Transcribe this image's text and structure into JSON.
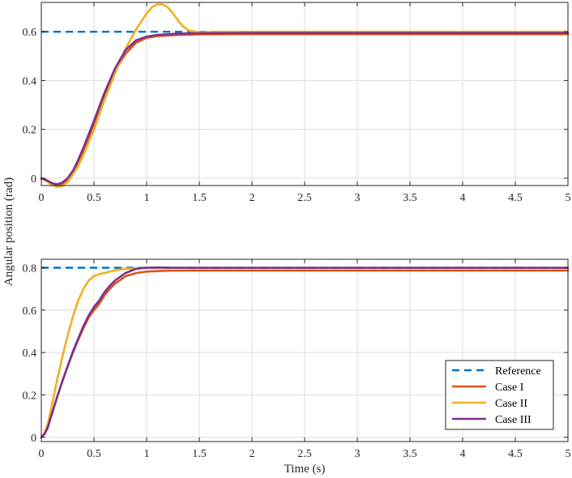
{
  "colors": {
    "reference": "#0072BD",
    "case1": "#D95319",
    "case2": "#EDB120",
    "case3": "#7E2F8E",
    "grid": "#DCDCDC",
    "axis": "#262626"
  },
  "labels": {
    "ylabel": "Angular position (rad)",
    "xlabel": "Time (s)"
  },
  "chart_data": [
    {
      "type": "line",
      "title": "",
      "grid": true,
      "xlim": [
        0,
        5
      ],
      "ylim": [
        -0.03,
        0.72
      ],
      "xticks": [
        "0",
        "0.5",
        "1",
        "1.5",
        "2",
        "2.5",
        "3",
        "3.5",
        "4",
        "4.5",
        "5"
      ],
      "yticks": [
        "0",
        "0.2",
        "0.4",
        "0.6"
      ],
      "series": [
        {
          "name": "Reference",
          "style": "dashed",
          "color": "#0072BD",
          "points": [
            [
              0,
              0.6
            ],
            [
              5,
              0.6
            ]
          ]
        },
        {
          "name": "Case I",
          "style": "solid",
          "color": "#D95319",
          "points": [
            [
              0,
              0
            ],
            [
              0.05,
              -0.01
            ],
            [
              0.1,
              -0.025
            ],
            [
              0.15,
              -0.032
            ],
            [
              0.2,
              -0.028
            ],
            [
              0.25,
              -0.01
            ],
            [
              0.3,
              0.02
            ],
            [
              0.35,
              0.06
            ],
            [
              0.4,
              0.11
            ],
            [
              0.5,
              0.22
            ],
            [
              0.6,
              0.34
            ],
            [
              0.7,
              0.44
            ],
            [
              0.8,
              0.51
            ],
            [
              0.9,
              0.555
            ],
            [
              1.0,
              0.575
            ],
            [
              1.1,
              0.582
            ],
            [
              1.3,
              0.587
            ],
            [
              1.5,
              0.589
            ],
            [
              2,
              0.59
            ],
            [
              5,
              0.59
            ]
          ]
        },
        {
          "name": "Case II",
          "style": "solid",
          "color": "#EDB120",
          "points": [
            [
              0,
              0
            ],
            [
              0.05,
              -0.012
            ],
            [
              0.1,
              -0.028
            ],
            [
              0.15,
              -0.036
            ],
            [
              0.2,
              -0.032
            ],
            [
              0.25,
              -0.015
            ],
            [
              0.3,
              0.015
            ],
            [
              0.35,
              0.05
            ],
            [
              0.4,
              0.095
            ],
            [
              0.5,
              0.2
            ],
            [
              0.6,
              0.32
            ],
            [
              0.7,
              0.43
            ],
            [
              0.8,
              0.53
            ],
            [
              0.9,
              0.61
            ],
            [
              1.0,
              0.675
            ],
            [
              1.05,
              0.7
            ],
            [
              1.1,
              0.712
            ],
            [
              1.15,
              0.712
            ],
            [
              1.2,
              0.7
            ],
            [
              1.25,
              0.675
            ],
            [
              1.3,
              0.645
            ],
            [
              1.35,
              0.62
            ],
            [
              1.4,
              0.605
            ],
            [
              1.5,
              0.598
            ],
            [
              1.7,
              0.6
            ],
            [
              2,
              0.6
            ],
            [
              5,
              0.6
            ]
          ]
        },
        {
          "name": "Case III",
          "style": "solid",
          "color": "#7E2F8E",
          "points": [
            [
              0,
              0
            ],
            [
              0.05,
              -0.008
            ],
            [
              0.1,
              -0.02
            ],
            [
              0.15,
              -0.025
            ],
            [
              0.2,
              -0.018
            ],
            [
              0.25,
              0.0
            ],
            [
              0.3,
              0.03
            ],
            [
              0.35,
              0.075
            ],
            [
              0.4,
              0.125
            ],
            [
              0.5,
              0.235
            ],
            [
              0.6,
              0.35
            ],
            [
              0.7,
              0.45
            ],
            [
              0.8,
              0.525
            ],
            [
              0.9,
              0.565
            ],
            [
              1.0,
              0.58
            ],
            [
              1.1,
              0.587
            ],
            [
              1.3,
              0.592
            ],
            [
              1.5,
              0.594
            ],
            [
              2,
              0.595
            ],
            [
              5,
              0.595
            ]
          ]
        }
      ]
    },
    {
      "type": "line",
      "title": "",
      "grid": true,
      "xlim": [
        0,
        5
      ],
      "ylim": [
        -0.02,
        0.84
      ],
      "xticks": [
        "0",
        "0.5",
        "1",
        "1.5",
        "2",
        "2.5",
        "3",
        "3.5",
        "4",
        "4.5",
        "5"
      ],
      "yticks": [
        "0",
        "0.2",
        "0.4",
        "0.6",
        "0.8"
      ],
      "legend": {
        "location": "bottom-right",
        "entries": [
          "Reference",
          "Case I",
          "Case II",
          "Case III"
        ]
      },
      "series": [
        {
          "name": "Reference",
          "style": "dashed",
          "color": "#0072BD",
          "points": [
            [
              0,
              0.8
            ],
            [
              5,
              0.8
            ]
          ]
        },
        {
          "name": "Case I",
          "style": "solid",
          "color": "#D95319",
          "points": [
            [
              0,
              0
            ],
            [
              0.03,
              0.015
            ],
            [
              0.06,
              0.045
            ],
            [
              0.1,
              0.11
            ],
            [
              0.15,
              0.19
            ],
            [
              0.2,
              0.265
            ],
            [
              0.25,
              0.335
            ],
            [
              0.3,
              0.4
            ],
            [
              0.35,
              0.46
            ],
            [
              0.4,
              0.515
            ],
            [
              0.45,
              0.565
            ],
            [
              0.5,
              0.6
            ],
            [
              0.55,
              0.63
            ],
            [
              0.6,
              0.67
            ],
            [
              0.65,
              0.7
            ],
            [
              0.7,
              0.725
            ],
            [
              0.8,
              0.76
            ],
            [
              0.9,
              0.775
            ],
            [
              1.0,
              0.782
            ],
            [
              1.2,
              0.786
            ],
            [
              1.5,
              0.787
            ],
            [
              5,
              0.787
            ]
          ]
        },
        {
          "name": "Case II",
          "style": "solid",
          "color": "#EDB120",
          "points": [
            [
              0,
              0
            ],
            [
              0.03,
              0.02
            ],
            [
              0.06,
              0.06
            ],
            [
              0.1,
              0.15
            ],
            [
              0.15,
              0.27
            ],
            [
              0.2,
              0.38
            ],
            [
              0.25,
              0.48
            ],
            [
              0.3,
              0.57
            ],
            [
              0.35,
              0.645
            ],
            [
              0.4,
              0.7
            ],
            [
              0.45,
              0.74
            ],
            [
              0.5,
              0.76
            ],
            [
              0.55,
              0.77
            ],
            [
              0.6,
              0.775
            ],
            [
              0.7,
              0.788
            ],
            [
              0.8,
              0.795
            ],
            [
              0.9,
              0.797
            ],
            [
              1.0,
              0.8
            ],
            [
              5,
              0.8
            ]
          ]
        },
        {
          "name": "Case III",
          "style": "solid",
          "color": "#7E2F8E",
          "points": [
            [
              0,
              0
            ],
            [
              0.03,
              0.015
            ],
            [
              0.06,
              0.045
            ],
            [
              0.1,
              0.11
            ],
            [
              0.15,
              0.19
            ],
            [
              0.2,
              0.265
            ],
            [
              0.25,
              0.335
            ],
            [
              0.3,
              0.405
            ],
            [
              0.35,
              0.465
            ],
            [
              0.4,
              0.525
            ],
            [
              0.45,
              0.575
            ],
            [
              0.5,
              0.615
            ],
            [
              0.55,
              0.645
            ],
            [
              0.6,
              0.685
            ],
            [
              0.65,
              0.715
            ],
            [
              0.7,
              0.74
            ],
            [
              0.8,
              0.775
            ],
            [
              0.9,
              0.795
            ],
            [
              1.0,
              0.8
            ],
            [
              1.1,
              0.801
            ],
            [
              1.3,
              0.8
            ],
            [
              5,
              0.8
            ]
          ]
        }
      ]
    }
  ]
}
